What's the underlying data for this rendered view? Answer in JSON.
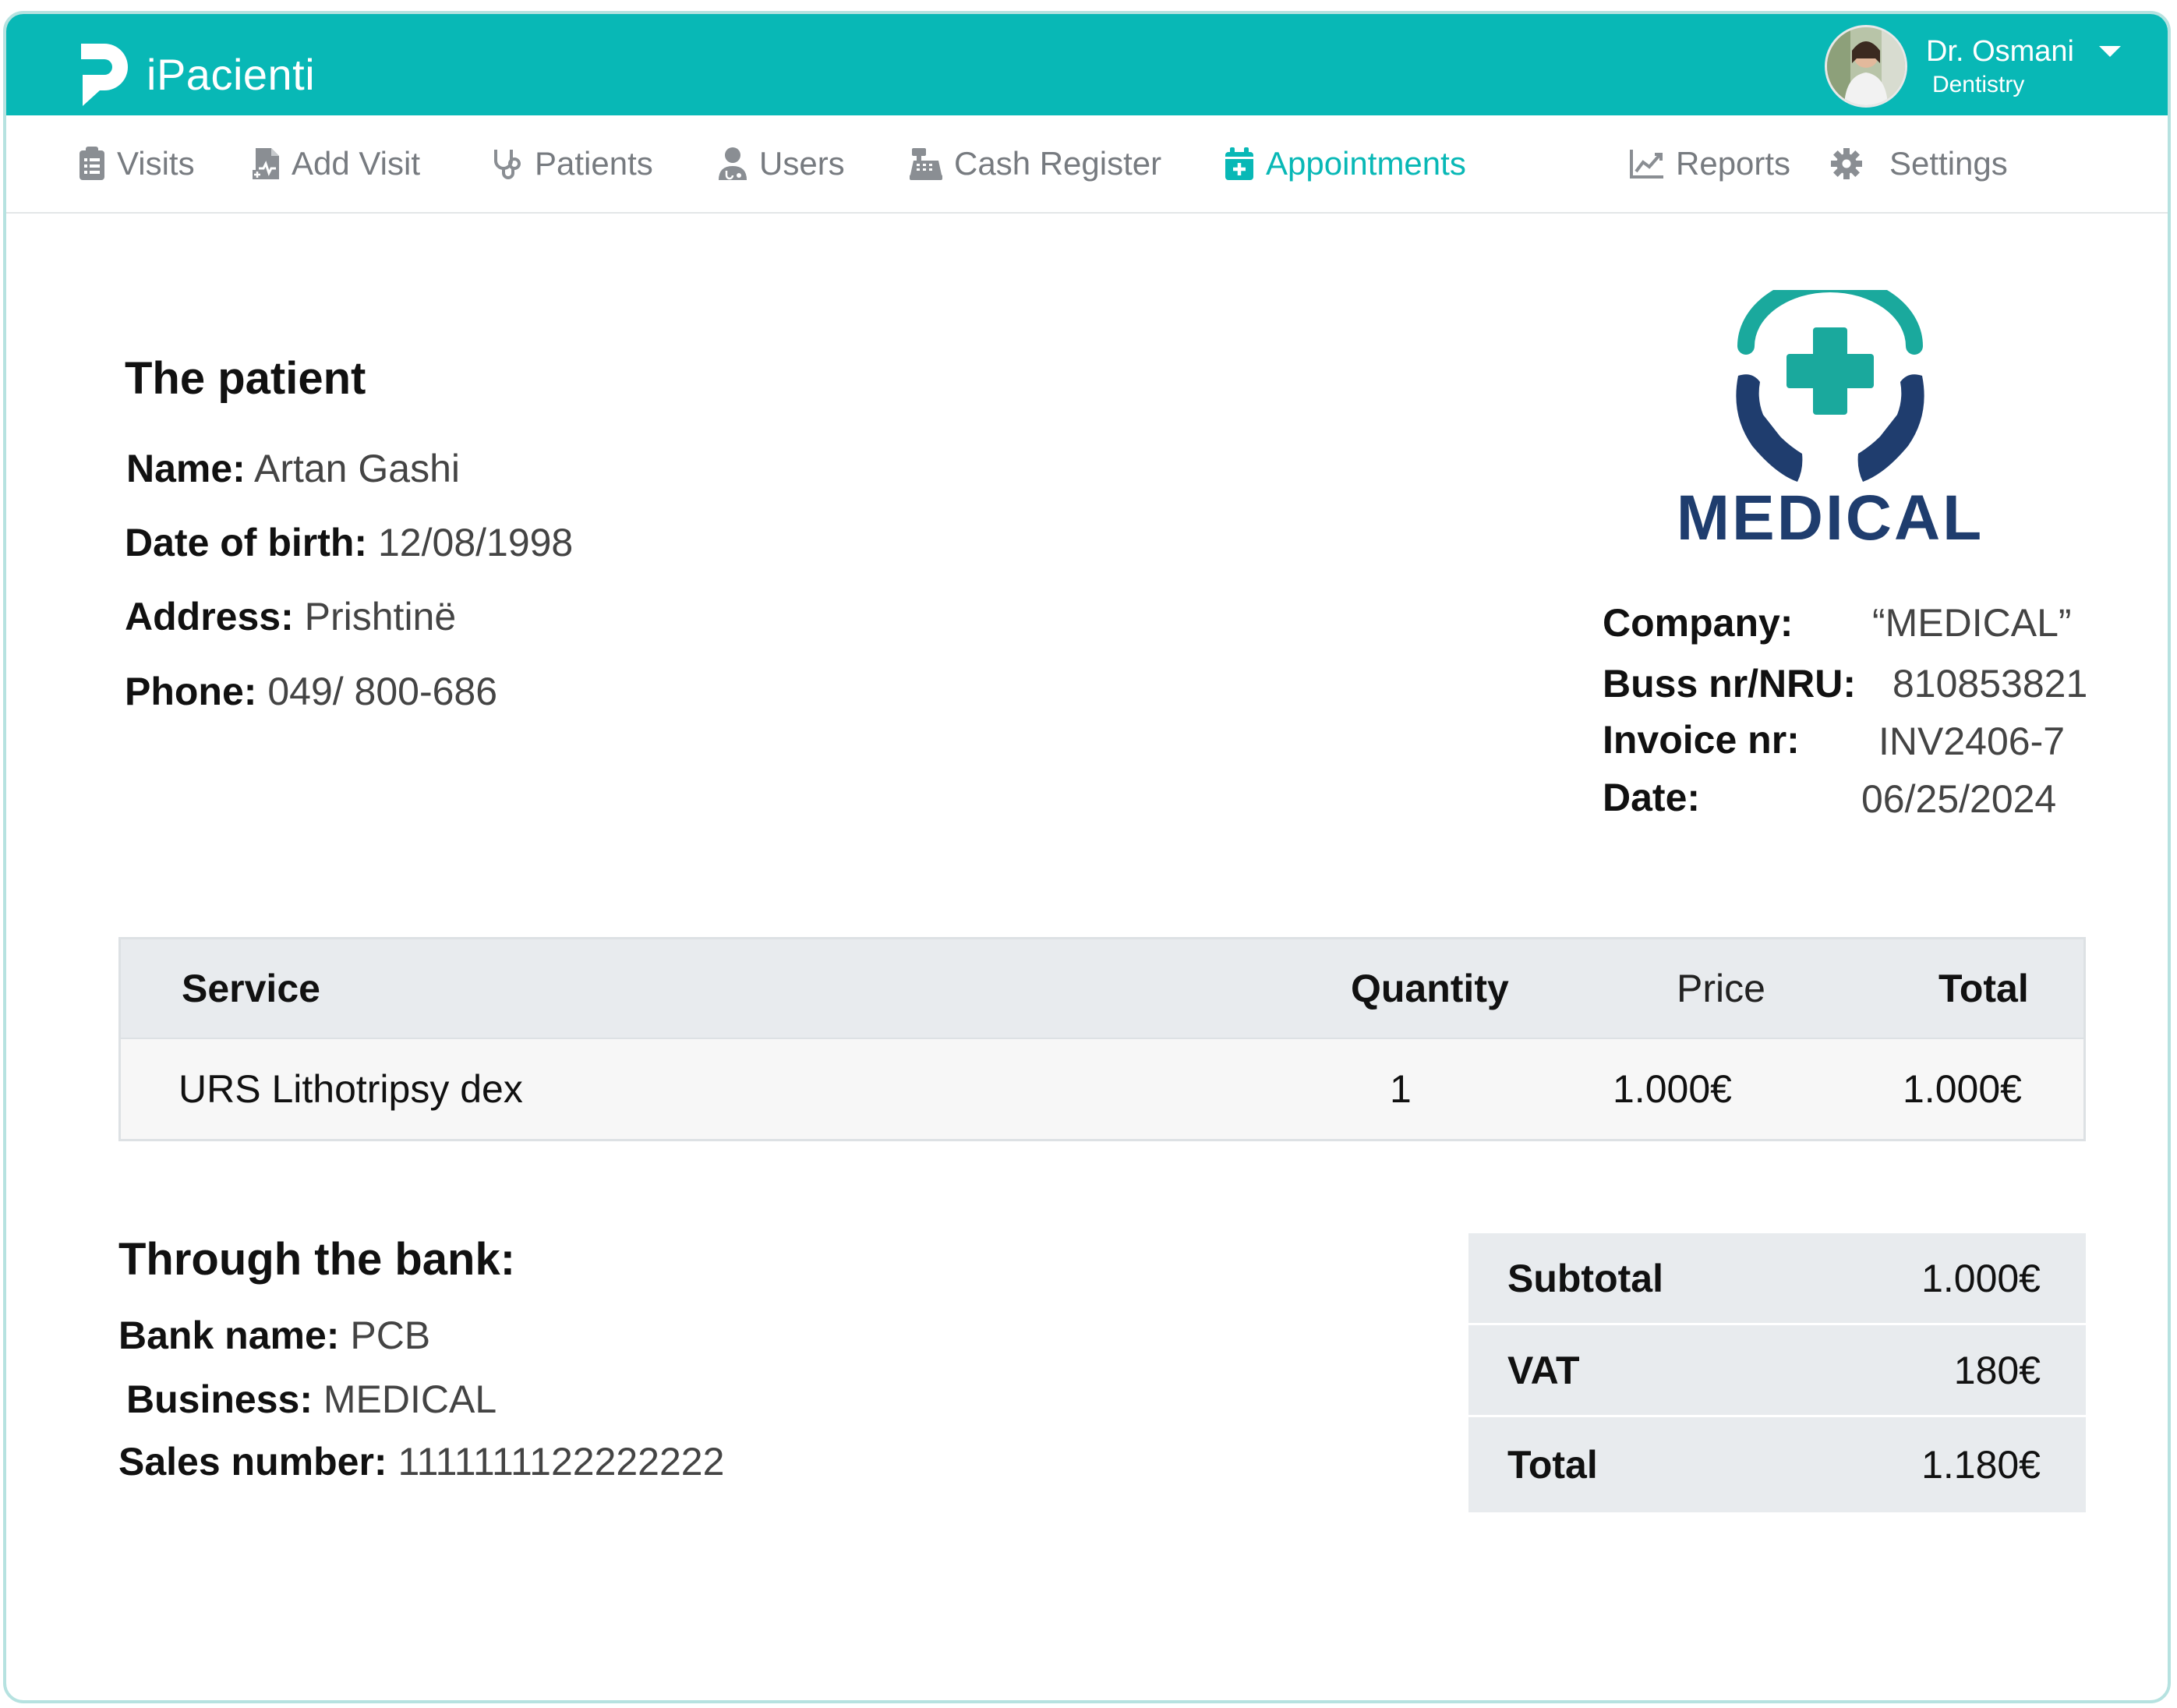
{
  "app": {
    "name": "iPacienti"
  },
  "user": {
    "name": "Dr. Osmani",
    "specialty": "Dentistry"
  },
  "nav": {
    "items": [
      {
        "label": "Visits",
        "icon": "clipboard-icon"
      },
      {
        "label": "Add Visit",
        "icon": "file-add-icon"
      },
      {
        "label": "Patients",
        "icon": "stethoscope-icon"
      },
      {
        "label": "Users",
        "icon": "user-doctor-icon"
      },
      {
        "label": "Cash Register",
        "icon": "cash-register-icon"
      },
      {
        "label": "Appointments",
        "icon": "calendar-plus-icon",
        "active": true
      },
      {
        "label": "Reports",
        "icon": "chart-line-icon"
      },
      {
        "label": "Settings",
        "icon": "gear-icon"
      }
    ]
  },
  "patient": {
    "heading": "The patient",
    "name_label": "Name:",
    "name": "Artan Gashi",
    "dob_label": "Date of birth:",
    "dob": "12/08/1998",
    "address_label": "Address:",
    "address": "Prishtinë",
    "phone_label": "Phone:",
    "phone": "049/ 800-686"
  },
  "company": {
    "logo_text": "MEDICAL",
    "company_label": "Company:",
    "company": "“MEDICAL”",
    "buss_label": "Buss nr/NRU:",
    "buss": "810853821",
    "invoice_label": "Invoice nr:",
    "invoice": "INV2406-7",
    "date_label": "Date:",
    "date": "06/25/2024"
  },
  "services": {
    "headers": {
      "service": "Service",
      "quantity": "Quantity",
      "price": "Price",
      "total": "Total"
    },
    "rows": [
      {
        "service": "URS Lithotripsy dex",
        "quantity": "1",
        "price": "1.000€",
        "total": "1.000€"
      }
    ]
  },
  "bank": {
    "heading": "Through the bank:",
    "bank_label": "Bank name:",
    "bank": "PCB",
    "business_label": "Business:",
    "business": "MEDICAL",
    "sales_label": "Sales number:",
    "sales": "1111111122222222"
  },
  "totals": {
    "subtotal_label": "Subtotal",
    "subtotal": "1.000€",
    "vat_label": "VAT",
    "vat": "180€",
    "total_label": "Total",
    "total": "1.180€"
  },
  "colors": {
    "accent": "#08b8b6",
    "brand_navy": "#1f3d6e",
    "brand_teal": "#1aa99d",
    "nav_text": "#777b80"
  }
}
